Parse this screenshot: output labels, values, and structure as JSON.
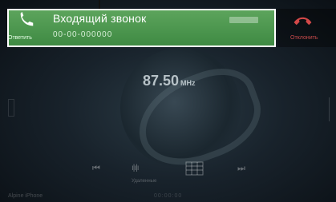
{
  "call": {
    "title": "Входящий звонок",
    "number": "00-00-000000",
    "answer_label": "Ответить",
    "decline_label": "Отклонить",
    "accent": "#4f9b52",
    "decline_color": "#c94b4b"
  },
  "player": {
    "frequency": "87.50",
    "unit": "MHz",
    "bluetooth_label": "Удаленные",
    "device_name": "Alpine iPhone",
    "center_text": "00:00:00"
  },
  "icons": {
    "answer": "phone-icon",
    "decline": "hangup-icon",
    "previous": "previous-track-icon",
    "next": "next-track-icon",
    "equalizer": "equalizer-icon",
    "grid": "grid-icon"
  }
}
